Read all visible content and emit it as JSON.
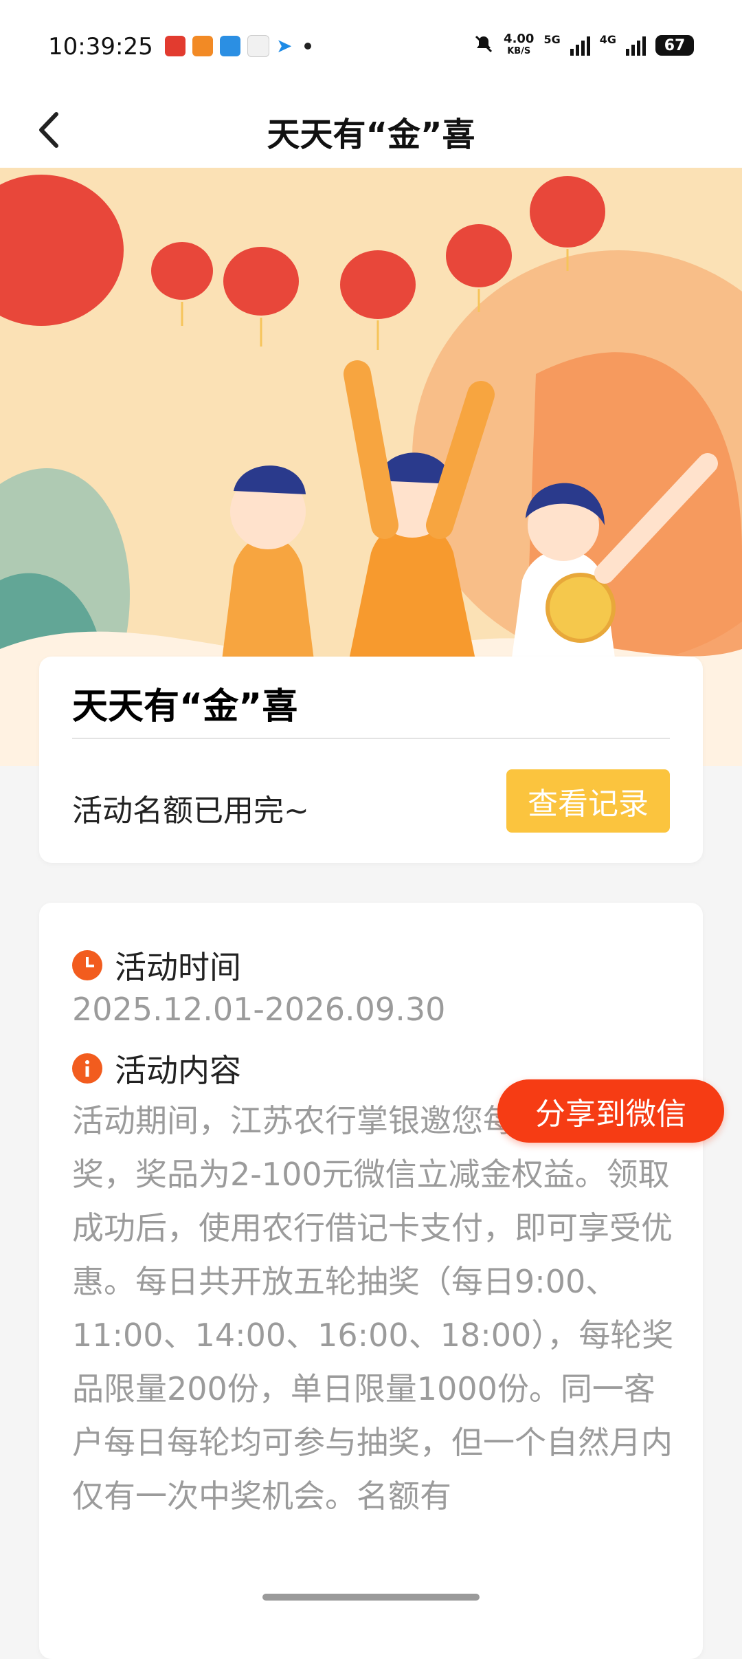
{
  "status_bar": {
    "time": "10:39:25",
    "speed_value": "4.00",
    "speed_unit": "KB/S",
    "network_1": "5G",
    "network_2": "4G",
    "battery": "67",
    "icons": [
      "app-icon-red",
      "app-icon-orange",
      "app-icon-blue",
      "app-icon-white",
      "app-icon-arrow",
      "more-dot",
      "mute-icon",
      "signal-icon",
      "signal-icon",
      "battery-icon"
    ]
  },
  "nav": {
    "back_icon": "chevron-left-icon",
    "title": "天天有“金”喜"
  },
  "activity_card": {
    "title": "天天有“金”喜",
    "status": "活动名额已用完~",
    "view_records_label": "查看记录"
  },
  "details": {
    "time_heading": "活动时间",
    "time_value": "2025.12.01-2026.09.30",
    "content_heading": "活动内容",
    "content_text": "活动期间，江苏农行掌银邀您每日参与抽奖，奖品为2-100元微信立减金权益。领取成功后，使用农行借记卡支付，即可享受优惠。每日共开放五轮抽奖（每日9:00、11:00、14:00、16:00、18:00），每轮奖品限量200份，单日限量1000份。同一客户每日每轮均可参与抽奖，但一个自然月内仅有一次中奖机会。名额有"
  },
  "share_label": "分享到微信",
  "colors": {
    "accent_yellow": "#fbc43e",
    "share_red": "#f63c14",
    "icon_orange": "#f25c1e",
    "text_gray": "#9b9b9b"
  }
}
